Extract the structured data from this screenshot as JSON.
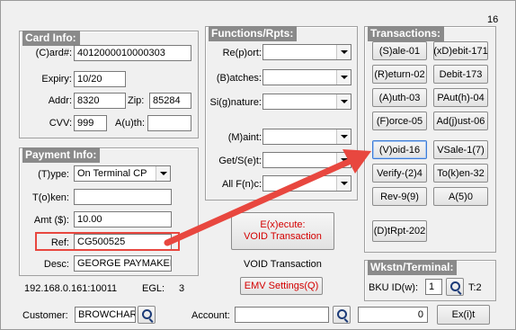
{
  "window": {
    "corner_number": "16"
  },
  "card_info": {
    "title": "Card Info:",
    "card_label": "(C)ard#:",
    "card_value": "4012000010000303",
    "expiry_label": "Expiry:",
    "expiry_value": "10/20",
    "addr_label": "Addr:",
    "addr_value": "8320",
    "zip_label": "Zip:",
    "zip_value": "85284",
    "cvv_label": "CVV:",
    "cvv_value": "999",
    "auth_label": "A(u)th:",
    "auth_value": ""
  },
  "payment_info": {
    "title": "Payment Info:",
    "type_label": "(T)ype:",
    "type_value": "On Terminal CP",
    "token_label": "T(o)ken:",
    "token_value": "",
    "amt_label": "Amt ($):",
    "amt_value": "10.00",
    "ref_label": "Ref:",
    "ref_value": "CG500525",
    "desc_label": "Desc:",
    "desc_value": "GEORGE PAYMAKER"
  },
  "status": {
    "ip": "192.168.0.161:10011",
    "egl_label": "EGL:",
    "egl_value": "3"
  },
  "functions": {
    "title": "Functions/Rpts:",
    "report_label": "Re(p)ort:",
    "report_value": "",
    "batches_label": "(B)atches:",
    "batches_value": "",
    "signature_label": "Si(g)nature:",
    "signature_value": "",
    "maint_label": "(M)aint:",
    "maint_value": "",
    "getset_label": "Get/S(e)t:",
    "getset_value": "",
    "allfnc_label": "All F(n)c:",
    "allfnc_value": ""
  },
  "execute": {
    "line1": "E(x)ecute:",
    "line2": "VOID Transaction",
    "caption": "VOID Transaction",
    "emv_label": "EMV Settings(Q)"
  },
  "transactions": {
    "title": "Transactions:",
    "buttons": [
      "(S)ale-01",
      "(xD)ebit-171",
      "(R)eturn-02",
      "Debit-173",
      "(A)uth-03",
      "PAut(h)-04",
      "(F)orce-05",
      "Ad(j)ust-06",
      "(V)oid-16",
      "VSale-1(7)",
      "Verify-(2)4",
      "To(k)en-32",
      "Rev-9(9)",
      "A(5)0",
      "(D)tRpt-202"
    ]
  },
  "workstation": {
    "title": "Wkstn/Terminal:",
    "bku_label": "BKU ID(w):",
    "bku_value": "1",
    "terminal_value": "T:2"
  },
  "bottom": {
    "customer_label": "Customer:",
    "customer_value": "BROWCHAR",
    "account_label": "Account:",
    "account_value": "",
    "counter_value": "0",
    "exit_label": "Ex(i)t"
  },
  "colors": {
    "annotation_red": "#e8473f",
    "execute_red": "#d40000",
    "selected_border": "#3d7bd6"
  },
  "icons": [
    "search-icon",
    "dropdown-arrow-icon"
  ]
}
